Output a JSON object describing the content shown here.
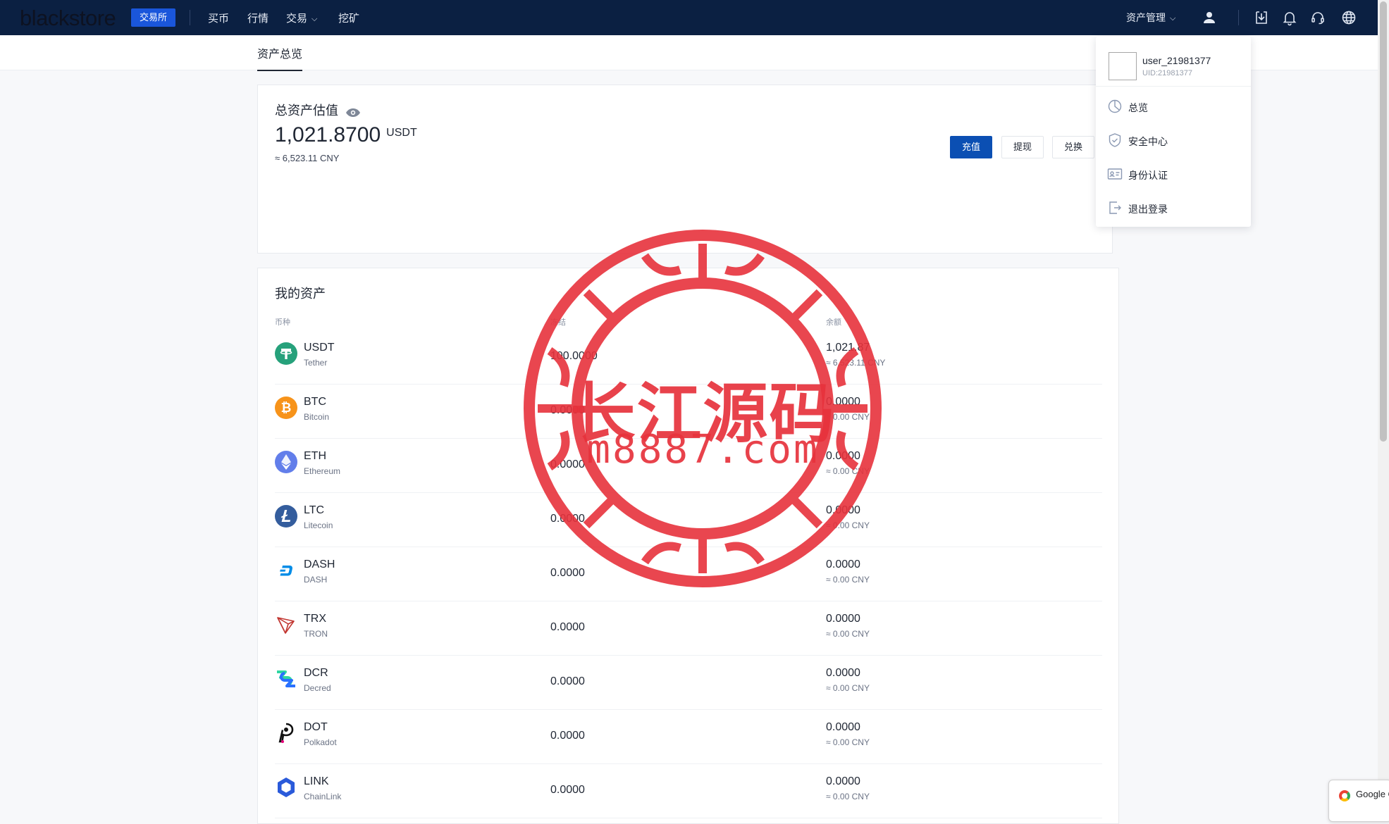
{
  "nav": {
    "logo": "blackstore",
    "badge": "交易所",
    "items": [
      {
        "label": "买币"
      },
      {
        "label": "行情"
      },
      {
        "label": "交易"
      },
      {
        "label": "挖矿"
      }
    ],
    "asset_mgmt": "资产管理",
    "icons": [
      "user-icon",
      "download-icon",
      "bell-icon",
      "headset-icon",
      "globe-icon"
    ]
  },
  "subnav": {
    "tab": "资产总览"
  },
  "summary": {
    "title": "总资产估值",
    "amount": "1,021.8700",
    "unit": "USDT",
    "cny": "≈ 6,523.11 CNY",
    "buttons": {
      "deposit": "充值",
      "withdraw": "提现",
      "exchange": "兑换"
    }
  },
  "assets": {
    "title": "我的资产",
    "headers": {
      "coin": "币种",
      "frozen": "冻结",
      "available": "余额"
    },
    "rows": [
      {
        "symbol": "USDT",
        "name": "Tether",
        "frozen": "100.0000",
        "available": "1,021.87",
        "cny": "≈ 6,523.11 CNY",
        "icon": "tether-icon"
      },
      {
        "symbol": "BTC",
        "name": "Bitcoin",
        "frozen": "0.0000",
        "available": "0.0000",
        "cny": "≈ 0.00 CNY",
        "icon": "bitcoin-icon"
      },
      {
        "symbol": "ETH",
        "name": "Ethereum",
        "frozen": "0.0000",
        "available": "0.0000",
        "cny": "≈ 0.00 CNY",
        "icon": "ethereum-icon"
      },
      {
        "symbol": "LTC",
        "name": "Litecoin",
        "frozen": "0.0000",
        "available": "0.0000",
        "cny": "≈ 0.00 CNY",
        "icon": "litecoin-icon"
      },
      {
        "symbol": "DASH",
        "name": "DASH",
        "frozen": "0.0000",
        "available": "0.0000",
        "cny": "≈ 0.00 CNY",
        "icon": "dash-icon"
      },
      {
        "symbol": "TRX",
        "name": "TRON",
        "frozen": "0.0000",
        "available": "0.0000",
        "cny": "≈ 0.00 CNY",
        "icon": "tron-icon"
      },
      {
        "symbol": "DCR",
        "name": "Decred",
        "frozen": "0.0000",
        "available": "0.0000",
        "cny": "≈ 0.00 CNY",
        "icon": "decred-icon"
      },
      {
        "symbol": "DOT",
        "name": "Polkadot",
        "frozen": "0.0000",
        "available": "0.0000",
        "cny": "≈ 0.00 CNY",
        "icon": "polkadot-icon"
      },
      {
        "symbol": "LINK",
        "name": "ChainLink",
        "frozen": "0.0000",
        "available": "0.0000",
        "cny": "≈ 0.00 CNY",
        "icon": "chainlink-icon"
      }
    ]
  },
  "dropdown": {
    "username": "user_21981377",
    "uid": "UID:21981377",
    "items": [
      {
        "label": "总览",
        "icon": "overview-icon"
      },
      {
        "label": "安全中心",
        "icon": "shield-icon"
      },
      {
        "label": "身份认证",
        "icon": "id-card-icon"
      },
      {
        "label": "退出登录",
        "icon": "logout-icon"
      }
    ]
  },
  "watermark": {
    "title": "长江源码",
    "url": "m8887.com"
  },
  "chrome_popup": {
    "label": "Google C"
  },
  "colors": {
    "nav_bg": "#0b2042",
    "primary": "#0b4fb3",
    "badge": "#1a56db",
    "seal": "#e7323c"
  }
}
